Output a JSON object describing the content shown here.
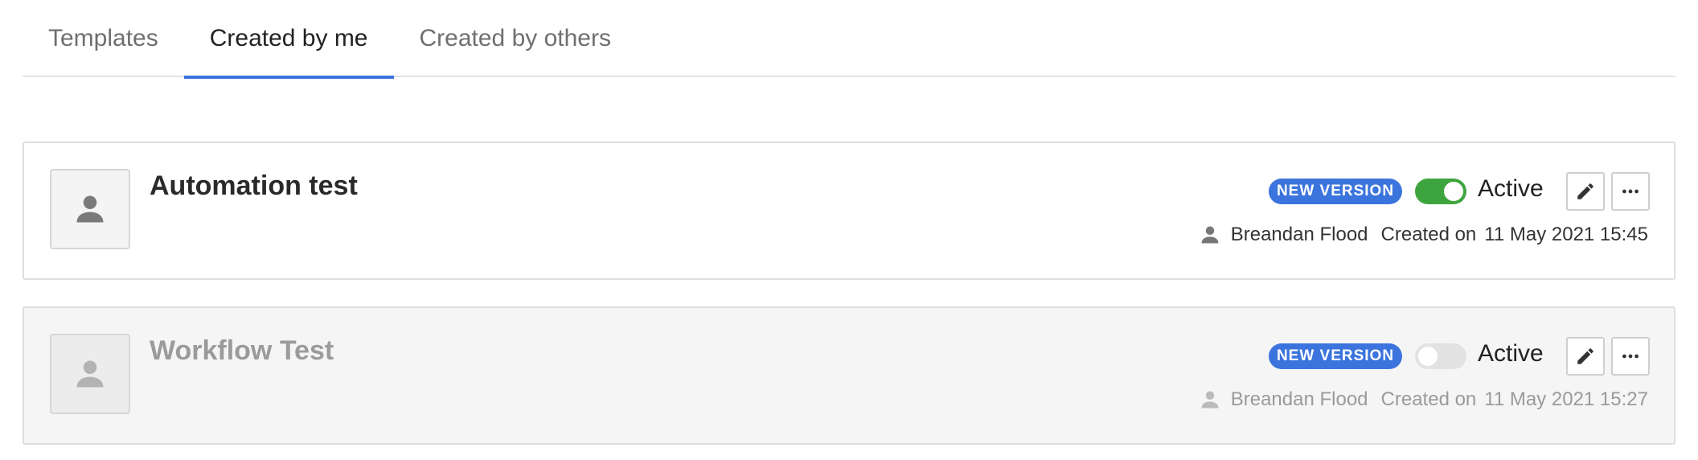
{
  "tabs": [
    {
      "label": "Templates",
      "active": false
    },
    {
      "label": "Created by me",
      "active": true
    },
    {
      "label": "Created by others",
      "active": false
    }
  ],
  "workflows": [
    {
      "title": "Automation test",
      "badge": "NEW VERSION",
      "toggle_on": true,
      "status": "Active",
      "author": "Breandan Flood",
      "created_label": "Created on",
      "created_date": "11 May 2021 15:45"
    },
    {
      "title": "Workflow Test",
      "badge": "NEW VERSION",
      "toggle_on": false,
      "status": "Active",
      "author": "Breandan Flood",
      "created_label": "Created on",
      "created_date": "11 May 2021 15:27"
    }
  ],
  "colors": {
    "accent": "#3b74dd",
    "toggle_on": "#3ea53e",
    "toggle_off": "#e2e2e2",
    "disabled_bg": "#f5f5f5"
  },
  "icons": {
    "avatar": "person-icon",
    "author": "user-icon",
    "edit": "pencil-icon",
    "more": "more-horizontal-icon"
  }
}
